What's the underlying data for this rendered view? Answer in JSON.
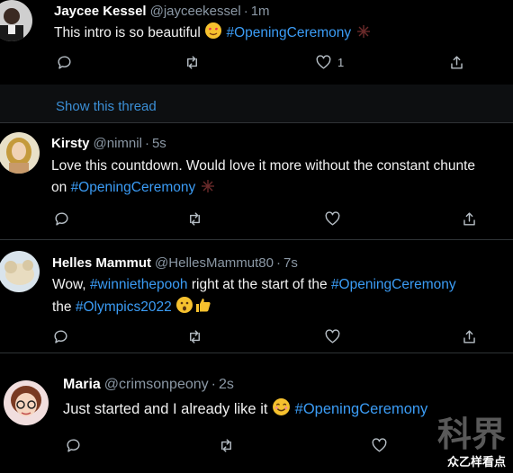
{
  "tweets": [
    {
      "name": "Jaycee Kessel",
      "handle": "@jayceekessel",
      "time": "1m",
      "text_a": "This intro is so beautiful",
      "hashtag1": "#OpeningCeremony",
      "like_count": "1"
    },
    {
      "name": "Kirsty",
      "handle": "@nimnil",
      "time": "5s",
      "line1": "Love this countdown. Would love it more without the constant chunte",
      "line2_a": "on",
      "hashtag1": "#OpeningCeremony"
    },
    {
      "name": "Helles Mammut",
      "handle": "@HellesMammut80",
      "time": "7s",
      "line1_a": "Wow,",
      "hashtag1": "#winniethepooh",
      "line1_b": "right at the start of the",
      "hashtag2": "#OpeningCeremony",
      "line2_a": "the",
      "hashtag3": "#Olympics2022"
    },
    {
      "name": "Maria",
      "handle": "@crimsonpeony",
      "time": "2s",
      "text_a": "Just started and I already like it",
      "hashtag1": "#OpeningCeremony"
    }
  ],
  "show_thread": "Show this thread",
  "separator": "·",
  "watermark": {
    "big": "科界",
    "small": "众乙样看点"
  },
  "icons": [
    "reply-icon",
    "retweet-icon",
    "like-icon",
    "share-icon"
  ],
  "colors": {
    "background": "#000000",
    "hashtag": "#3b9cf5",
    "muted": "#8b98a5"
  }
}
